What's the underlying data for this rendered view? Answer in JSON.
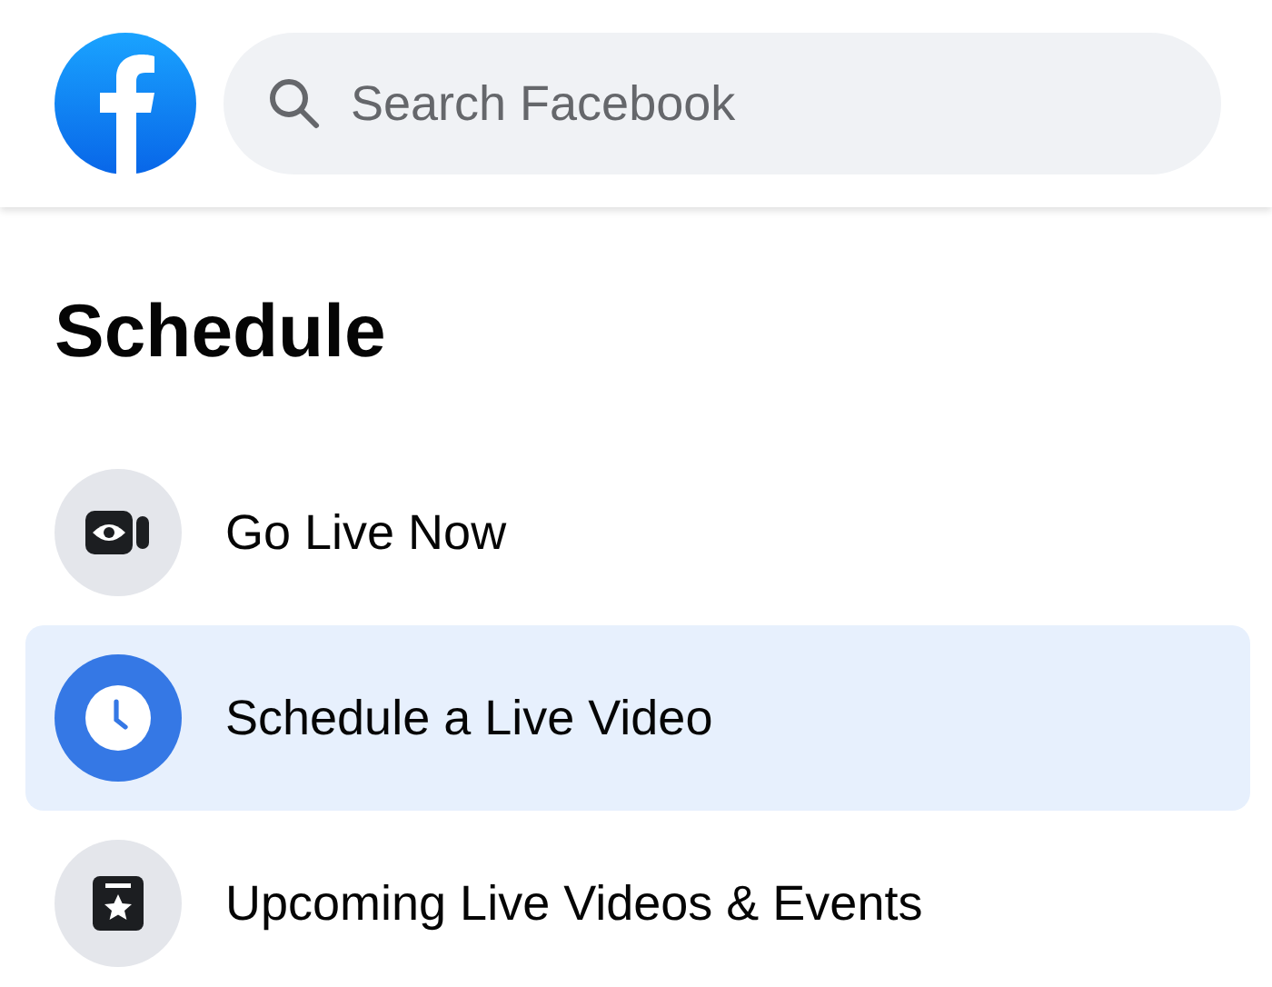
{
  "search": {
    "placeholder": "Search Facebook"
  },
  "title": "Schedule",
  "items": [
    {
      "label": "Go Live Now",
      "kind": "camera",
      "selected": false
    },
    {
      "label": "Schedule a Live Video",
      "kind": "clock",
      "selected": true
    },
    {
      "label": "Upcoming Live Videos & Events",
      "kind": "star",
      "selected": false
    }
  ]
}
